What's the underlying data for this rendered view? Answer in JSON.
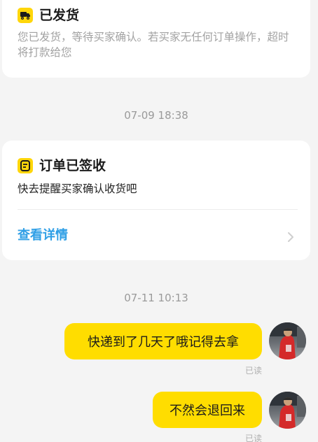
{
  "shipped_card": {
    "title": "已发货",
    "description": "您已发货，等待买家确认。若买家无任何订单操作，超时将打款给您",
    "icon": "truck-icon"
  },
  "timestamp_1": "07-09 18:38",
  "signed_card": {
    "title": "订单已签收",
    "description": "快去提醒买家确认收货吧",
    "detail_link": "查看详情",
    "icon": "receipt-icon"
  },
  "timestamp_2": "07-11 10:13",
  "messages": [
    {
      "text": "快递到了几天了哦记得去拿",
      "status": "已读"
    },
    {
      "text": "不然会退回来",
      "status": "已读"
    }
  ],
  "colors": {
    "bubble": "#ffdd00",
    "link": "#2f9fe6",
    "icon_accent": "#ffd60a"
  }
}
